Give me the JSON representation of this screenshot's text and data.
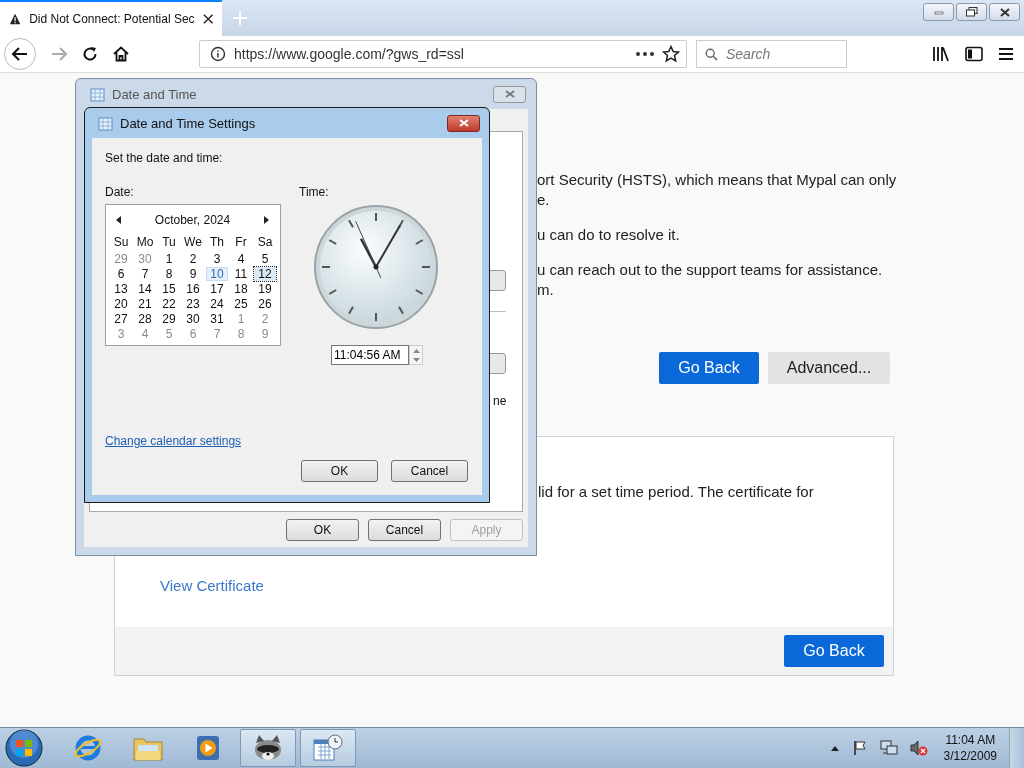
{
  "browser": {
    "tabs": [
      {
        "title": "Did Not Connect: Potential Sec",
        "selected": true
      }
    ],
    "address": "https://www.google.com/?gws_rd=ssl",
    "search": {
      "placeholder": "Search"
    }
  },
  "page": {
    "paragraphs": [
      [
        "ort Security (HSTS), which means that Mypal can only",
        "e."
      ],
      [
        "u can do to resolve it."
      ],
      [
        "u can reach out to the support teams for assistance.",
        "m."
      ]
    ],
    "buttons": [
      {
        "label": "Go Back",
        "kind": "primary"
      },
      {
        "label": "Advanced...",
        "kind": "secondary"
      }
    ],
    "details": {
      "text": "lid for a set time period. The certificate for",
      "link": "View Certificate",
      "button": "Go Back"
    }
  },
  "date_time_dialog": {
    "title": "Date and Time",
    "fragment": "ne",
    "buttons": [
      {
        "label": "OK",
        "disabled": false
      },
      {
        "label": "Cancel",
        "disabled": false
      },
      {
        "label": "Apply",
        "disabled": true
      }
    ]
  },
  "settings_dialog": {
    "title": "Date and Time Settings",
    "prompt": "Set the date and time:",
    "date_label": "Date:",
    "time_label": "Time:",
    "calendar": {
      "month": "October, 2024",
      "weekdays": [
        "Su",
        "Mo",
        "Tu",
        "We",
        "Th",
        "Fr",
        "Sa"
      ],
      "weeks": [
        [
          {
            "d": "29",
            "muted": true,
            "today": false,
            "selected": false
          },
          {
            "d": "30",
            "muted": true,
            "today": false,
            "selected": false
          },
          {
            "d": "1",
            "muted": false,
            "today": false,
            "selected": false
          },
          {
            "d": "2",
            "muted": false,
            "today": false,
            "selected": false
          },
          {
            "d": "3",
            "muted": false,
            "today": false,
            "selected": false
          },
          {
            "d": "4",
            "muted": false,
            "today": false,
            "selected": false
          },
          {
            "d": "5",
            "muted": false,
            "today": false,
            "selected": false
          }
        ],
        [
          {
            "d": "6",
            "muted": false,
            "today": false,
            "selected": false
          },
          {
            "d": "7",
            "muted": false,
            "today": false,
            "selected": false
          },
          {
            "d": "8",
            "muted": false,
            "today": false,
            "selected": false
          },
          {
            "d": "9",
            "muted": false,
            "today": false,
            "selected": false
          },
          {
            "d": "10",
            "muted": false,
            "today": true,
            "selected": false
          },
          {
            "d": "11",
            "muted": false,
            "today": false,
            "selected": false
          },
          {
            "d": "12",
            "muted": false,
            "today": false,
            "selected": true
          }
        ],
        [
          {
            "d": "13",
            "muted": false,
            "today": false,
            "selected": false
          },
          {
            "d": "14",
            "muted": false,
            "today": false,
            "selected": false
          },
          {
            "d": "15",
            "muted": false,
            "today": false,
            "selected": false
          },
          {
            "d": "16",
            "muted": false,
            "today": false,
            "selected": false
          },
          {
            "d": "17",
            "muted": false,
            "today": false,
            "selected": false
          },
          {
            "d": "18",
            "muted": false,
            "today": false,
            "selected": false
          },
          {
            "d": "19",
            "muted": false,
            "today": false,
            "selected": false
          }
        ],
        [
          {
            "d": "20",
            "muted": false,
            "today": false,
            "selected": false
          },
          {
            "d": "21",
            "muted": false,
            "today": false,
            "selected": false
          },
          {
            "d": "22",
            "muted": false,
            "today": false,
            "selected": false
          },
          {
            "d": "23",
            "muted": false,
            "today": false,
            "selected": false
          },
          {
            "d": "24",
            "muted": false,
            "today": false,
            "selected": false
          },
          {
            "d": "25",
            "muted": false,
            "today": false,
            "selected": false
          },
          {
            "d": "26",
            "muted": false,
            "today": false,
            "selected": false
          }
        ],
        [
          {
            "d": "27",
            "muted": false,
            "today": false,
            "selected": false
          },
          {
            "d": "28",
            "muted": false,
            "today": false,
            "selected": false
          },
          {
            "d": "29",
            "muted": false,
            "today": false,
            "selected": false
          },
          {
            "d": "30",
            "muted": false,
            "today": false,
            "selected": false
          },
          {
            "d": "31",
            "muted": false,
            "today": false,
            "selected": false
          },
          {
            "d": "1",
            "muted": true,
            "today": false,
            "selected": false
          },
          {
            "d": "2",
            "muted": true,
            "today": false,
            "selected": false
          }
        ],
        [
          {
            "d": "3",
            "muted": true,
            "today": false,
            "selected": false
          },
          {
            "d": "4",
            "muted": true,
            "today": false,
            "selected": false
          },
          {
            "d": "5",
            "muted": true,
            "today": false,
            "selected": false
          },
          {
            "d": "6",
            "muted": true,
            "today": false,
            "selected": false
          },
          {
            "d": "7",
            "muted": true,
            "today": false,
            "selected": false
          },
          {
            "d": "8",
            "muted": true,
            "today": false,
            "selected": false
          },
          {
            "d": "9",
            "muted": true,
            "today": false,
            "selected": false
          }
        ]
      ]
    },
    "time": "11:04:56 AM",
    "link": "Change calendar settings",
    "buttons": [
      {
        "label": "OK",
        "disabled": false
      },
      {
        "label": "Cancel",
        "disabled": false
      }
    ]
  },
  "taskbar": {
    "items": [
      {
        "kind": "browser",
        "selected": false
      },
      {
        "kind": "folder",
        "selected": false
      },
      {
        "kind": "media",
        "selected": false
      },
      {
        "kind": "raccoon",
        "selected": true
      },
      {
        "kind": "calendar",
        "selected": true
      }
    ],
    "clock": {
      "time": "11:04 AM",
      "date": "3/12/2009"
    }
  }
}
